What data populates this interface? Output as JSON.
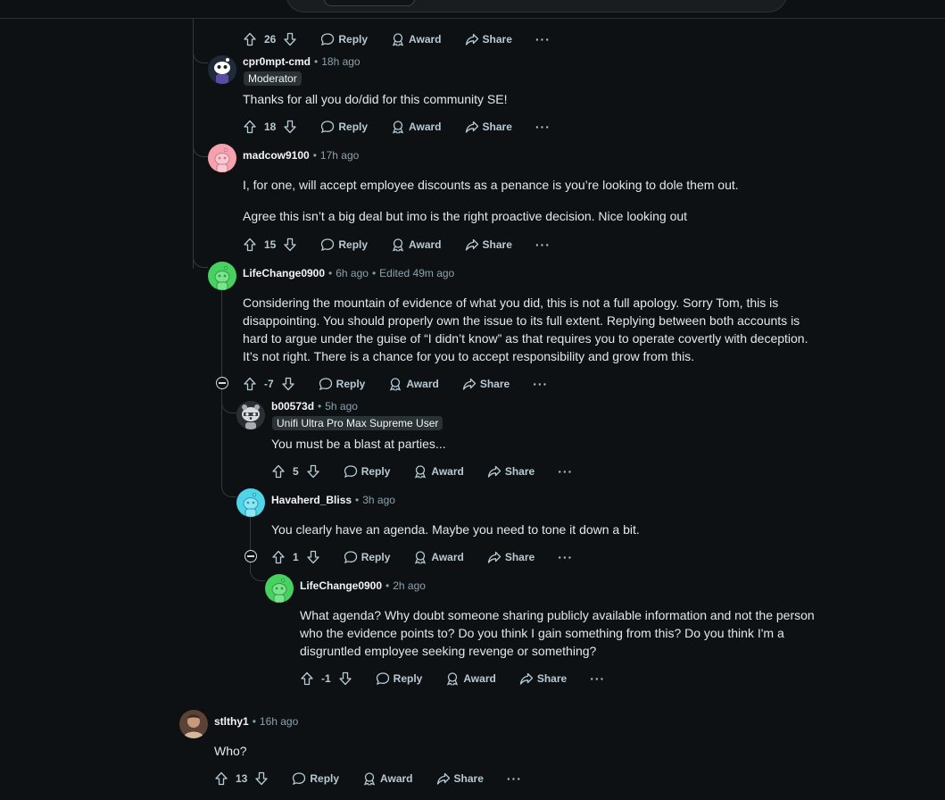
{
  "labels": {
    "reply": "Reply",
    "award": "Award",
    "share": "Share",
    "more": "···"
  },
  "colors": {
    "background": "#0e1113",
    "thread_line": "#33393d",
    "meta_text": "#8ba2ad"
  },
  "top_actions": {
    "score": "26"
  },
  "comments": [
    {
      "author": "cpr0mpt-cmd",
      "time": "18h ago",
      "flair": "Moderator",
      "avatar": "moderator-avatar",
      "paragraphs": [
        "Thanks for all you do/did for this community SE!"
      ],
      "score": "18"
    },
    {
      "author": "madcow9100",
      "time": "17h ago",
      "avatar": "pink-snoo-avatar",
      "paragraphs": [
        "I, for one, will accept employee discounts as a penance is you’re looking to dole them out.",
        "Agree this isn’t a big deal but imo is the right proactive decision. Nice looking out"
      ],
      "score": "15"
    },
    {
      "author": "LifeChange0900",
      "time": "6h ago",
      "edited": "Edited 49m ago",
      "avatar": "green-snoo-avatar",
      "paragraphs": [
        "Considering the mountain of evidence of what you did, this is not a full apology. Sorry Tom, this is disappointing. You should properly own the issue to its full extent. Replying between both accounts is hard to argue under the guise of “I didn’t know” as that requires you to operate covertly with deception. It’s not right. There is a chance for you to accept responsibility and grow from this."
      ],
      "score": "-7"
    },
    {
      "author": "b00573d",
      "time": "5h ago",
      "flair": "Unifi Ultra Pro Max Supreme User",
      "avatar": "raccoon-avatar",
      "paragraphs": [
        "You must be a blast at parties..."
      ],
      "score": "5"
    },
    {
      "author": "Havaherd_Bliss",
      "time": "3h ago",
      "avatar": "cyan-snoo-avatar",
      "paragraphs": [
        "You clearly have an agenda. Maybe you need to tone it down a bit."
      ],
      "score": "1"
    },
    {
      "author": "LifeChange0900",
      "time": "2h ago",
      "avatar": "green-snoo-avatar",
      "paragraphs": [
        "What agenda? Why doubt someone sharing publicly available information and not the person who the evidence points to? Do you think I gain something from this? Do you think I'm a disgruntled employee seeking revenge or something?"
      ],
      "score": "-1"
    },
    {
      "author": "stlthy1",
      "time": "16h ago",
      "avatar": "photo-avatar",
      "paragraphs": [
        "Who?"
      ],
      "score": "13"
    }
  ]
}
